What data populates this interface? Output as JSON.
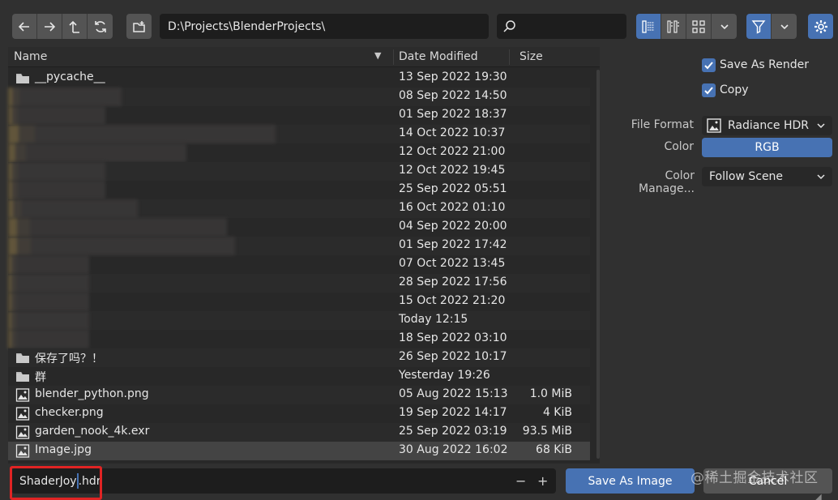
{
  "toolbar": {
    "path": "D:\\Projects\\BlenderProjects\\",
    "search_placeholder": ""
  },
  "columns": {
    "name": "Name",
    "date": "Date Modified",
    "size": "Size"
  },
  "files": [
    {
      "name": "__pycache__",
      "date": "13 Sep 2022 19:30",
      "size": "",
      "type": "folder"
    },
    {
      "name": "",
      "date": "08 Sep 2022 14:50",
      "size": "",
      "type": "blurred",
      "blur": 100
    },
    {
      "name": "",
      "date": "01 Sep 2022 18:37",
      "size": "",
      "type": "blurred",
      "blur": 80
    },
    {
      "name": "",
      "date": "14 Oct 2022 10:37",
      "size": "",
      "type": "blurred",
      "blur": 290
    },
    {
      "name": "",
      "date": "12 Oct 2022 21:00",
      "size": "",
      "type": "blurred",
      "blur": 180
    },
    {
      "name": "",
      "date": "12 Oct 2022 19:45",
      "size": "",
      "type": "blurred",
      "blur": 80
    },
    {
      "name": "",
      "date": "25 Sep 2022 05:51",
      "size": "",
      "type": "blurred",
      "blur": 80
    },
    {
      "name": "",
      "date": "16 Oct 2022 01:10",
      "size": "",
      "type": "blurred",
      "blur": 120
    },
    {
      "name": "",
      "date": "04 Sep 2022 20:00",
      "size": "",
      "type": "blurred",
      "blur": 230
    },
    {
      "name": "",
      "date": "01 Sep 2022 17:42",
      "size": "",
      "type": "blurred",
      "blur": 240
    },
    {
      "name": "",
      "date": "07 Oct 2022 13:45",
      "size": "",
      "type": "blurred",
      "blur": 60
    },
    {
      "name": "",
      "date": "28 Sep 2022 17:56",
      "size": "",
      "type": "blurred",
      "blur": 60
    },
    {
      "name": "",
      "date": "15 Oct 2022 21:20",
      "size": "",
      "type": "blurred",
      "blur": 60
    },
    {
      "name": "",
      "date": "Today 12:15",
      "size": "",
      "type": "blurred",
      "blur": 60
    },
    {
      "name": "",
      "date": "18 Sep 2022 03:10",
      "size": "",
      "type": "blurred",
      "blur": 60
    },
    {
      "name": "保存了吗？！",
      "date": "26 Sep 2022 10:17",
      "size": "",
      "type": "folder"
    },
    {
      "name": "群",
      "date": "Yesterday 19:26",
      "size": "",
      "type": "folder"
    },
    {
      "name": "blender_python.png",
      "date": "05 Aug 2022 15:13",
      "size": "1.0 MiB",
      "type": "image"
    },
    {
      "name": "checker.png",
      "date": "19 Sep 2022 14:17",
      "size": "4 KiB",
      "type": "image"
    },
    {
      "name": "garden_nook_4k.exr",
      "date": "25 Sep 2022 03:19",
      "size": "93.5 MiB",
      "type": "image"
    },
    {
      "name": "Image.jpg",
      "date": "30 Aug 2022 16:02",
      "size": "68 KiB",
      "type": "image",
      "selected": true
    }
  ],
  "sidebar": {
    "save_as_render": "Save As Render",
    "copy": "Copy",
    "file_format_label": "File Format",
    "file_format_value": "Radiance HDR",
    "color_label": "Color",
    "color_value": "RGB",
    "color_manage_label": "Color Manage...",
    "color_manage_value": "Follow Scene"
  },
  "bottom": {
    "filename_before": "ShaderJoy",
    "filename_after": ".hdr",
    "minus": "−",
    "plus": "+",
    "save_label": "Save As Image",
    "cancel_label": "Cancel",
    "watermark": "@稀土掘金技术社区"
  },
  "colors": {
    "accent": "#4772b3",
    "highlight": "#e02424",
    "folder": "#c9c9c9"
  }
}
